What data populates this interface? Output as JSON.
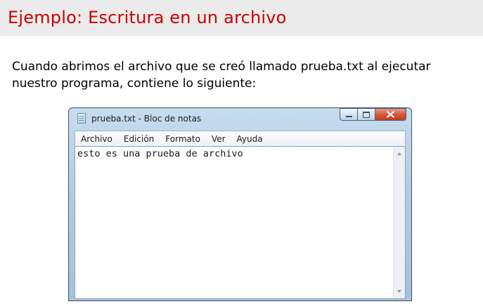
{
  "slide": {
    "title": "Ejemplo: Escritura en un archivo",
    "body": "Cuando abrimos el archivo que se creó llamado prueba.txt al ejecutar nuestro programa, contiene lo siguiente:"
  },
  "notepad": {
    "window_title": "prueba.txt - Bloc de notas",
    "menu": [
      "Archivo",
      "Edición",
      "Formato",
      "Ver",
      "Ayuda"
    ],
    "content": "esto es una prueba de archivo",
    "icons": {
      "app": "notepad-icon",
      "minimize": "minimize-icon",
      "maximize": "maximize-icon",
      "close": "close-icon",
      "scroll_up": "scroll-up-arrow-icon",
      "scroll_down": "scroll-down-arrow-icon"
    }
  },
  "colors": {
    "title_text": "#cc0000",
    "title_band": "#ebebeb",
    "window_frame": "#b2cbe3",
    "close_button": "#c43a1c"
  }
}
